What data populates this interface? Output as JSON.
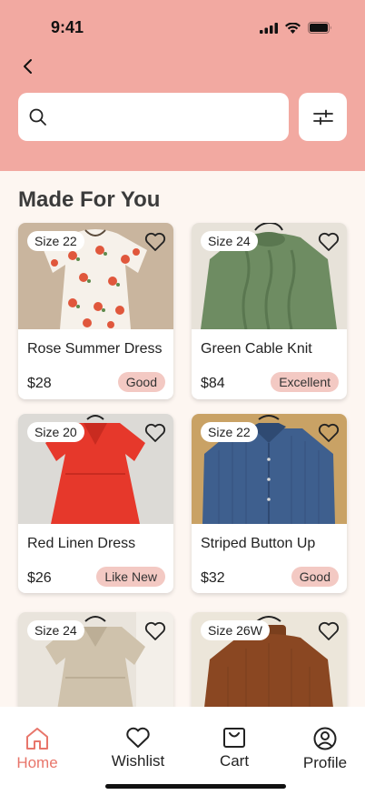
{
  "status_bar": {
    "time": "9:41"
  },
  "search": {
    "placeholder": "",
    "value": ""
  },
  "section_title": "Made For You",
  "colors": {
    "header": "#f2a9a1",
    "accent": "#e8766b",
    "badge": "#f3c9c3",
    "background": "#fdf6f1"
  },
  "products": [
    {
      "size": "Size 22",
      "name": "Rose Summer Dress",
      "price": "$28",
      "condition": "Good"
    },
    {
      "size": "Size 24",
      "name": "Green Cable Knit",
      "price": "$84",
      "condition": "Excellent"
    },
    {
      "size": "Size 20",
      "name": "Red Linen Dress",
      "price": "$26",
      "condition": "Like New"
    },
    {
      "size": "Size 22",
      "name": "Striped Button Up",
      "price": "$32",
      "condition": "Good"
    },
    {
      "size": "Size 24"
    },
    {
      "size": "Size 26W"
    }
  ],
  "nav": {
    "items": [
      {
        "label": "Home",
        "icon": "home-icon",
        "active": true
      },
      {
        "label": "Wishlist",
        "icon": "heart-icon",
        "active": false
      },
      {
        "label": "Cart",
        "icon": "shopping-bag-icon",
        "active": false
      },
      {
        "label": "Profile",
        "icon": "user-icon",
        "active": false
      }
    ]
  }
}
